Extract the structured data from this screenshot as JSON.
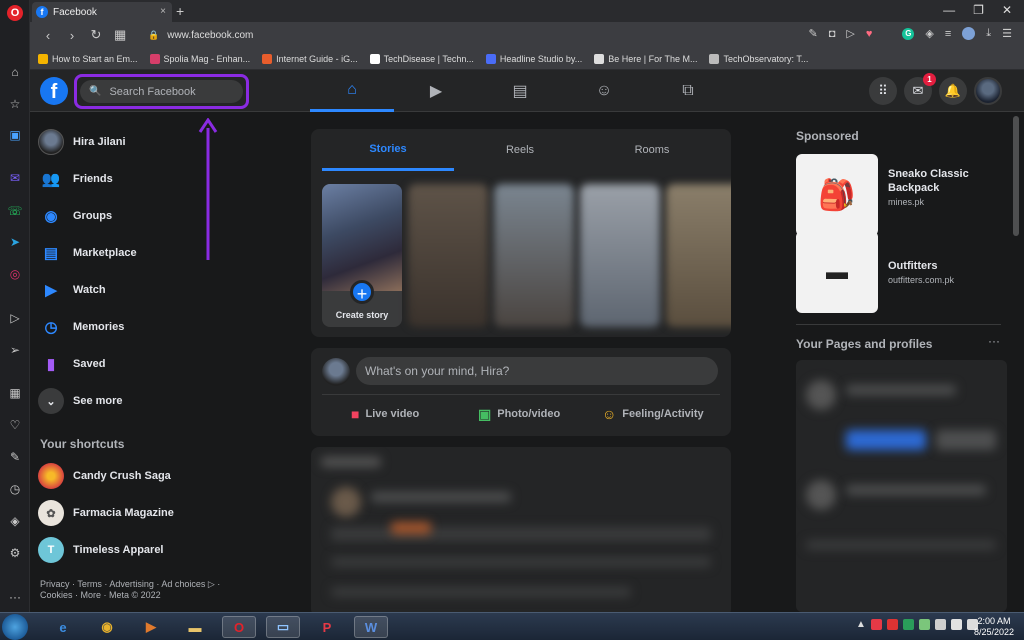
{
  "browser": {
    "tab_title": "Facebook",
    "tab_close": "×",
    "new_tab": "+",
    "url": "www.facebook.com",
    "window_controls": [
      "—",
      "❐",
      "✕"
    ],
    "bookmarks": [
      {
        "label": "How to Start an Em...",
        "color": "#f4b400"
      },
      {
        "label": "Spolia Mag - Enhan...",
        "color": "#d63e6a"
      },
      {
        "label": "Internet Guide - iG...",
        "color": "#e85d2c"
      },
      {
        "label": "TechDisease | Techn...",
        "color": "#ffffff"
      },
      {
        "label": "Headline Studio by...",
        "color": "#4a6cf7"
      },
      {
        "label": "Be Here | For The M...",
        "color": "#dddddd"
      },
      {
        "label": "TechObservatory: T...",
        "color": "#bbbbbb"
      }
    ]
  },
  "facebook": {
    "logo_letter": "f",
    "search_placeholder": "Search Facebook",
    "notification_count": "1",
    "left_nav": [
      {
        "label": "Hira Jilani",
        "icon": "profile-avatar"
      },
      {
        "label": "Friends",
        "icon": "friends-icon"
      },
      {
        "label": "Groups",
        "icon": "groups-icon"
      },
      {
        "label": "Marketplace",
        "icon": "marketplace-icon"
      },
      {
        "label": "Watch",
        "icon": "watch-icon"
      },
      {
        "label": "Memories",
        "icon": "memories-icon"
      },
      {
        "label": "Saved",
        "icon": "saved-icon"
      },
      {
        "label": "See more",
        "icon": "chevron-down-icon"
      }
    ],
    "shortcuts_title": "Your shortcuts",
    "shortcuts": [
      {
        "label": "Candy Crush Saga",
        "color": "#d8433f"
      },
      {
        "label": "Farmacia Magazine",
        "color": "#e9e4dc"
      },
      {
        "label": "Timeless Apparel",
        "color": "#6ec6d8",
        "initial": "T"
      }
    ],
    "footer": "Privacy · Terms · Advertising · Ad choices ▷ · Cookies · More · Meta © 2022",
    "stories_tabs": [
      "Stories",
      "Reels",
      "Rooms"
    ],
    "create_story": "Create story",
    "composer_placeholder": "What's on your mind, Hira?",
    "composer_actions": [
      {
        "label": "Live video",
        "color": "#f3425f"
      },
      {
        "label": "Photo/video",
        "color": "#45bd62"
      },
      {
        "label": "Feeling/Activity",
        "color": "#f7b928"
      }
    ],
    "sponsored_title": "Sponsored",
    "ads": [
      {
        "title": "Sneako Classic Backpack",
        "domain": "mines.pk"
      },
      {
        "title": "Outfitters",
        "domain": "outfitters.com.pk"
      }
    ],
    "pages_title": "Your Pages and profiles",
    "pages_more": "···"
  },
  "taskbar": {
    "time": "2:00 AM",
    "date": "8/25/2022"
  }
}
